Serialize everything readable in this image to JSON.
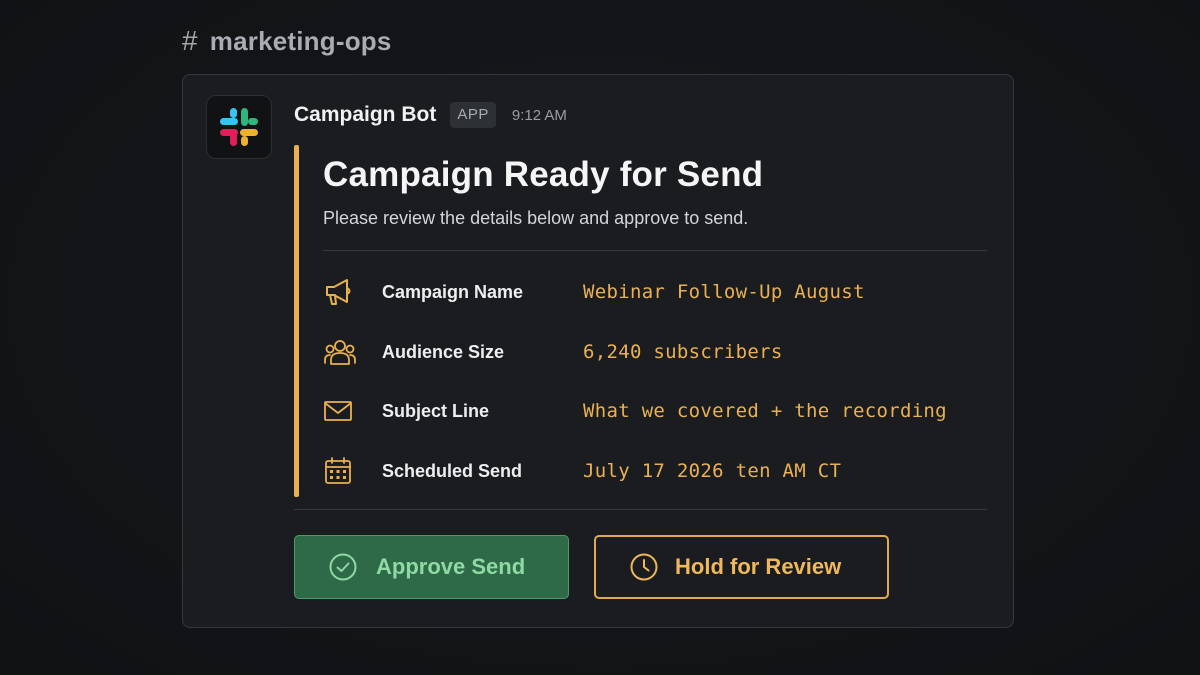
{
  "channel": {
    "hash": "#",
    "name": "marketing-ops"
  },
  "message": {
    "bot_name": "Campaign Bot",
    "badge": "APP",
    "timestamp": "9:12 AM",
    "avatar_icon": "slack-logo-icon"
  },
  "attachment": {
    "accent_color": "#e9b04f",
    "title": "Campaign Ready for Send",
    "subtitle": "Please review the details below and approve to send.",
    "fields": [
      {
        "icon": "megaphone-icon",
        "label": "Campaign Name",
        "value": "Webinar Follow-Up August"
      },
      {
        "icon": "users-icon",
        "label": "Audience Size",
        "value": "6,240 subscribers"
      },
      {
        "icon": "envelope-icon",
        "label": "Subject Line",
        "value": "What we covered + the recording"
      },
      {
        "icon": "calendar-icon",
        "label": "Scheduled Send",
        "value": "July 17 2026 ten AM CT"
      }
    ]
  },
  "actions": {
    "approve": {
      "label": "Approve Send",
      "icon": "check-circle-icon",
      "color": "#2e6a48"
    },
    "hold": {
      "label": "Hold for Review",
      "icon": "clock-icon",
      "color": "#e2aa4f"
    }
  }
}
